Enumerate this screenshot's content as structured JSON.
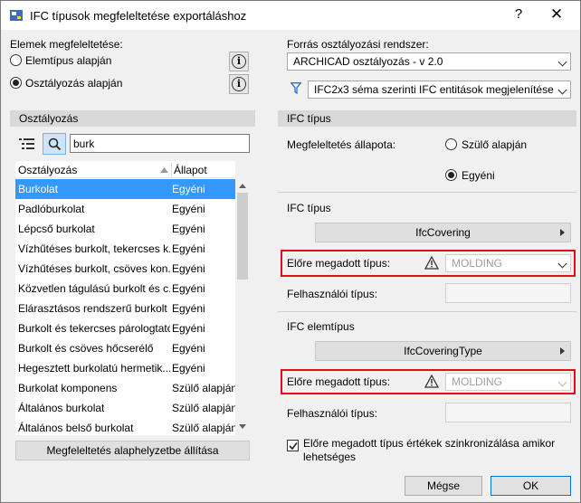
{
  "window": {
    "title": "IFC típusok megfeleltetése exportáláshoz",
    "help": "?",
    "close": "✕"
  },
  "left": {
    "mapping_label": "Elemek megfeleltetése:",
    "radio1": "Elemtípus alapján",
    "radio2": "Osztályozás alapján",
    "radio_selected": "radio2",
    "panel_title": "Osztályozás",
    "search_value": "burk",
    "col_class": "Osztályozás",
    "col_state": "Állapot",
    "rows": [
      {
        "name": "Burkolat",
        "state": "Egyéni"
      },
      {
        "name": "Padlóburkolat",
        "state": "Egyéni"
      },
      {
        "name": "Lépcső burkolat",
        "state": "Egyéni"
      },
      {
        "name": "Vízhűtéses burkolt, tekercses k...",
        "state": "Egyéni"
      },
      {
        "name": "Vízhűtéses burkolt, csöves kon...",
        "state": "Egyéni"
      },
      {
        "name": "Közvetlen tágulású burkolt és c...",
        "state": "Egyéni"
      },
      {
        "name": "Elárasztásos rendszerű burkolt ...",
        "state": "Egyéni"
      },
      {
        "name": "Burkolt és tekercses párologtató...",
        "state": "Egyéni"
      },
      {
        "name": "Burkolt és csöves hőcserélő",
        "state": "Egyéni"
      },
      {
        "name": "Hegesztett burkolatú hermetik...",
        "state": "Egyéni"
      },
      {
        "name": "Burkolat komponens",
        "state": "Szülő alapján"
      },
      {
        "name": "Általános burkolat",
        "state": "Szülő alapján"
      },
      {
        "name": "Általános belső burkolat",
        "state": "Szülő alapján"
      }
    ],
    "reset_button": "Megfeleltetés alaphelyzetbe állítása"
  },
  "right": {
    "source_label": "Forrás osztályozási rendszer:",
    "source_value": "ARCHICAD osztályozás - v 2.0",
    "filter_value": "IFC2x3 séma szerinti IFC entitások megjelenítése",
    "panel_title": "IFC típus",
    "state_label": "Megfeleltetés állapota:",
    "state_opt1": "Szülő alapján",
    "state_opt2": "Egyéni",
    "state_selected": "opt2",
    "ifc_type_section": "IFC típus",
    "ifc_type_value": "IfcCovering",
    "predef_label_1": "Előre megadott típus:",
    "predef_value_1": "MOLDING",
    "user_type_label_1": "Felhasználói típus:",
    "ifc_elem_section": "IFC elemtípus",
    "ifc_elem_value": "IfcCoveringType",
    "predef_label_2": "Előre megadott típus:",
    "predef_value_2": "MOLDING",
    "user_type_label_2": "Felhasználói típus:",
    "sync_label": "Előre megadott típus értékek szinkronizálása amikor lehetséges",
    "sync_checked": true
  },
  "footer": {
    "cancel": "Mégse",
    "ok": "OK"
  }
}
